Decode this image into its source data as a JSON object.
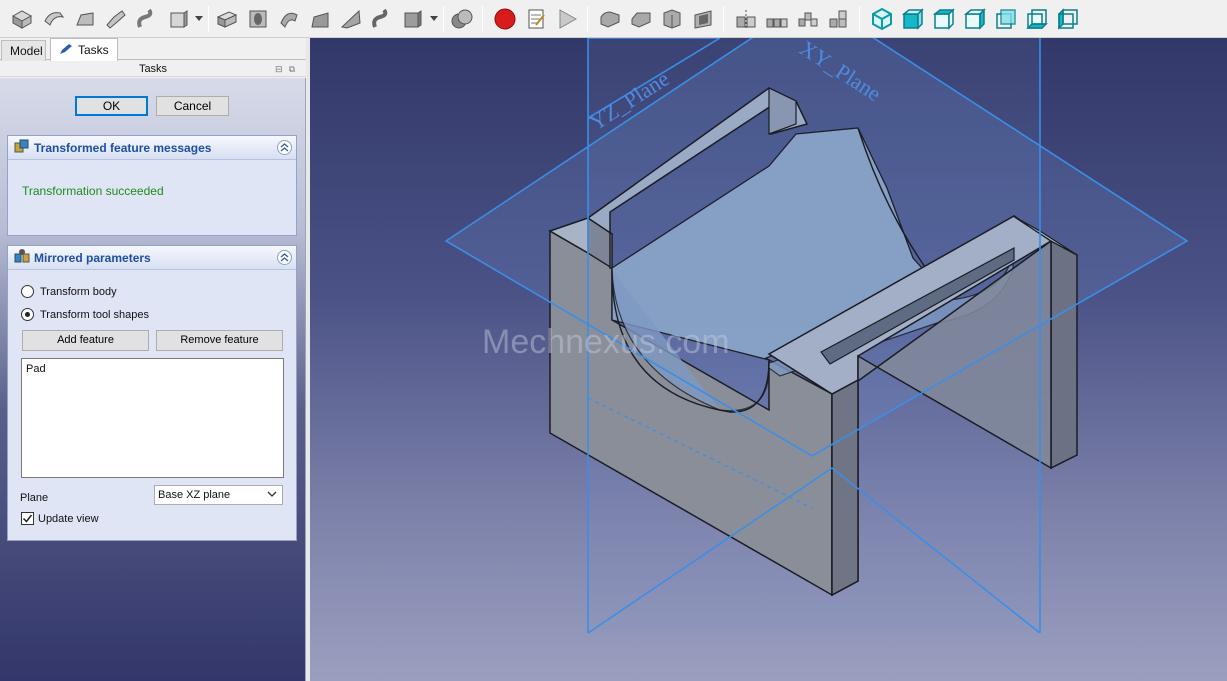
{
  "tabs": {
    "model": "Model",
    "tasks": "Tasks"
  },
  "taskbar": {
    "title": "Tasks"
  },
  "dialog": {
    "ok": "OK",
    "cancel": "Cancel"
  },
  "messages": {
    "title": "Transformed feature messages",
    "text": "Transformation succeeded"
  },
  "mirrored": {
    "title": "Mirrored parameters",
    "transform_body": "Transform body",
    "transform_tool_shapes": "Transform tool shapes",
    "selected_mode": "transform_tool_shapes",
    "add_feature": "Add feature",
    "remove_feature": "Remove feature",
    "features": [
      "Pad"
    ],
    "plane_label": "Plane",
    "plane_value": "Base XZ plane",
    "update_view": "Update view",
    "update_view_checked": true
  },
  "view": {
    "plane_labels": {
      "yz": "YZ_Plane",
      "xy": "XY_Plane"
    },
    "watermark": "Mechnexus.com"
  },
  "colors": {
    "plane_line": "#3a8ee8",
    "record_button": "#d81b1b",
    "view_icons": "#16b7c7",
    "success_text": "#1f8a1f",
    "section_title": "#1e4fa0"
  }
}
